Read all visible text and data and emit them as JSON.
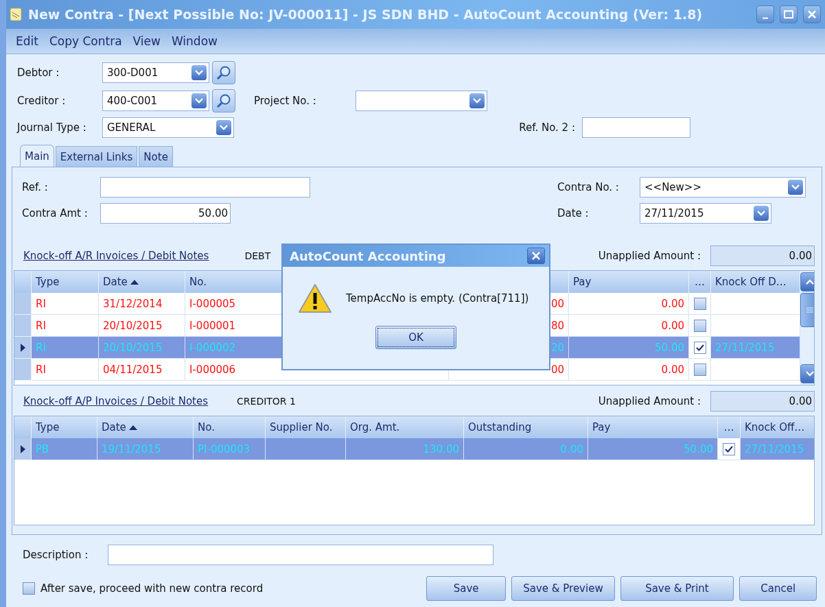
{
  "window": {
    "title": "New Contra - [Next Possible No: JV-000011] - JS SDN BHD - AutoCount Accounting (Ver: 1.8)"
  },
  "menu": [
    "Edit",
    "Copy Contra",
    "View",
    "Window"
  ],
  "header_fields": [
    {
      "label": "Debtor :",
      "value": "300-D001",
      "kind": "lookup"
    },
    {
      "label": "Creditor :",
      "value": "400-C001",
      "kind": "lookup"
    },
    {
      "label": "Journal Type :",
      "value": "GENERAL",
      "kind": "combo"
    }
  ],
  "project": {
    "label": "Project No. :"
  },
  "ref_no_2": {
    "label": "Ref. No. 2 :"
  },
  "tabs": [
    {
      "label": "Main",
      "selected": true
    },
    {
      "label": "External Links",
      "selected": false
    },
    {
      "label": "Note",
      "selected": false
    }
  ],
  "main": {
    "ref": {
      "label": "Ref. :"
    },
    "contra_amt": {
      "label": "Contra Amt :",
      "value": "50.00"
    },
    "contra_no": {
      "label": "Contra No. :",
      "value": "<<New>>"
    },
    "date": {
      "label": "Date :",
      "value": "27/11/2015"
    }
  },
  "ar_section": {
    "link": "Knock-off A/R Invoices / Debit Notes",
    "party": "DEBT",
    "unapplied_label": "Unapplied Amount :",
    "unapplied": "0.00",
    "columns": [
      {
        "label": "Type",
        "sorted": false,
        "kind": "text"
      },
      {
        "label": "Date",
        "sorted": true,
        "kind": "text"
      },
      {
        "label": "No.",
        "sorted": false,
        "kind": "text"
      },
      {
        "kind": "number"
      },
      {
        "label": "Pay",
        "sorted": false,
        "kind": "number"
      },
      {
        "label": "…",
        "sorted": false,
        "kind": "check"
      },
      {
        "label": "Knock Off D…",
        "sorted": false,
        "kind": "text"
      }
    ],
    "rows": [
      {
        "selected": false,
        "checked": false,
        "cells": [
          "RI",
          "31/12/2014",
          "I-000005",
          "00",
          "0.00",
          null,
          null
        ]
      },
      {
        "selected": false,
        "checked": false,
        "cells": [
          "RI",
          "20/10/2015",
          "I-000001",
          "80",
          "0.00",
          null,
          null
        ]
      },
      {
        "selected": true,
        "checked": true,
        "cells": [
          "RI",
          "20/10/2015",
          "I-000002",
          "20",
          "50.00",
          null,
          "27/11/2015"
        ]
      },
      {
        "selected": false,
        "checked": false,
        "cells": [
          "RI",
          "04/11/2015",
          "I-000006",
          "00",
          "0.00",
          null,
          null
        ]
      }
    ]
  },
  "ap_section": {
    "link": "Knock-off A/P Invoices / Debit Notes",
    "party": "CREDITOR 1",
    "unapplied_label": "Unapplied Amount :",
    "unapplied": "0.00",
    "columns": [
      {
        "label": "Type",
        "sorted": false,
        "kind": "text"
      },
      {
        "label": "Date",
        "sorted": true,
        "kind": "text"
      },
      {
        "label": "No.",
        "sorted": false,
        "kind": "text"
      },
      {
        "label": "Supplier No.",
        "sorted": false,
        "kind": "text"
      },
      {
        "label": "Org. Amt.",
        "sorted": false,
        "kind": "number"
      },
      {
        "label": "Outstanding",
        "sorted": false,
        "kind": "number"
      },
      {
        "label": "Pay",
        "sorted": false,
        "kind": "number"
      },
      {
        "label": "…",
        "sorted": false,
        "kind": "check"
      },
      {
        "label": "Knock Off…",
        "sorted": false,
        "kind": "text"
      }
    ],
    "rows": [
      {
        "selected": true,
        "checked": true,
        "cells": [
          "PB",
          "19/11/2015",
          "PI-000003",
          null,
          "130.00",
          "0.00",
          "50.00",
          null,
          "27/11/2015"
        ]
      }
    ]
  },
  "description": {
    "label": "Description :"
  },
  "proceed_option": {
    "label": "After save, proceed with new contra record",
    "checked": false
  },
  "buttons": [
    "Save",
    "Save & Preview",
    "Save & Print",
    "Cancel"
  ],
  "dialog": {
    "title": "AutoCount Accounting",
    "message": "TempAccNo is empty. (Contra[711])",
    "button": "OK"
  }
}
